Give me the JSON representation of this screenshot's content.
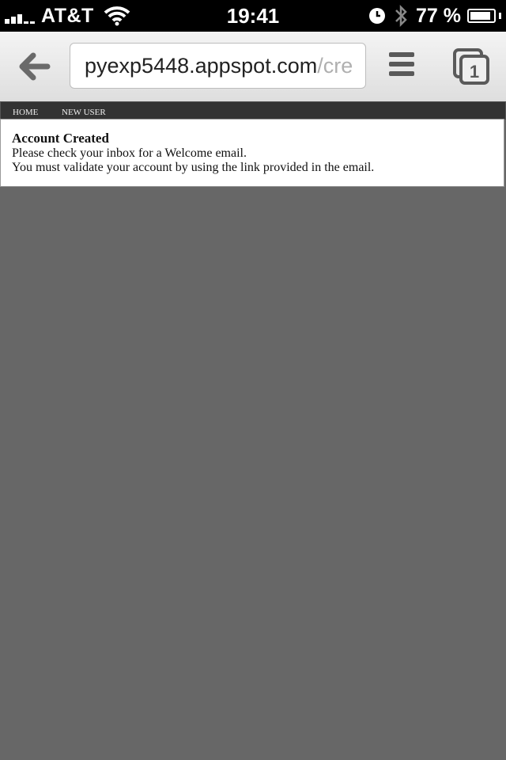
{
  "status_bar": {
    "carrier": "AT&T",
    "time": "19:41",
    "battery_percent": "77 %",
    "battery_level": 0.77,
    "icons": [
      "signal-icon",
      "wifi-icon",
      "clock-icon",
      "bluetooth-icon",
      "battery-icon"
    ]
  },
  "browser": {
    "url_host": "pyexp5448.appspot.com",
    "url_path": "/cre",
    "tab_count": "1",
    "icons": [
      "back-arrow-icon",
      "menu-icon",
      "tabs-icon"
    ]
  },
  "nav": {
    "items": [
      {
        "label": "HOME"
      },
      {
        "label": "NEW USER"
      }
    ]
  },
  "message": {
    "title": "Account Created",
    "line1": "Please check your inbox for a Welcome email.",
    "line2": "You must validate your account by using the link provided in the email."
  },
  "colors": {
    "page_background": "#676767",
    "navbar": "#333333",
    "status_bar": "#000000"
  }
}
